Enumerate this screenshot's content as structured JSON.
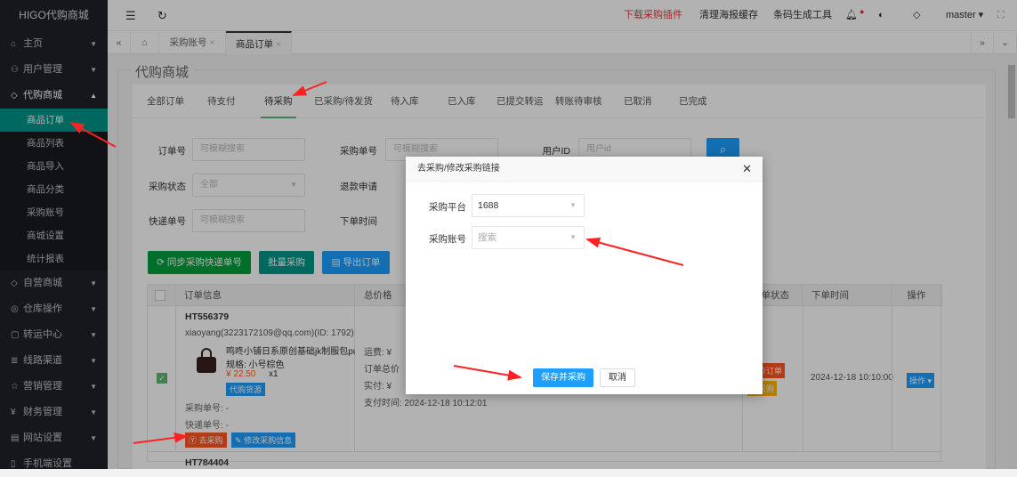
{
  "sidebar": {
    "logo": "HIGO代购商城",
    "items": [
      {
        "label": "主页",
        "icon": "home-icon"
      },
      {
        "label": "用户管理",
        "icon": "user-icon"
      },
      {
        "label": "代购商城",
        "icon": "tag-icon"
      }
    ],
    "sub": [
      "商品订单",
      "商品列表",
      "商品导入",
      "商品分类",
      "采购账号",
      "商城设置",
      "统计报表"
    ],
    "items2": [
      {
        "label": "自营商城",
        "icon": "tag-icon"
      },
      {
        "label": "仓库操作",
        "icon": "box-icon"
      },
      {
        "label": "转运中心",
        "icon": "note-icon"
      },
      {
        "label": "线路渠道",
        "icon": "route-icon"
      },
      {
        "label": "营销管理",
        "icon": "star-icon"
      },
      {
        "label": "财务管理",
        "icon": "yen-icon"
      },
      {
        "label": "网站设置",
        "icon": "window-icon"
      },
      {
        "label": "手机端设置",
        "icon": "phone-icon"
      }
    ]
  },
  "topbar": {
    "plugin": "下载采购插件",
    "clear": "清理海报缓存",
    "barcode": "条码生成工具",
    "user": "master",
    "accent": "#e4393c"
  },
  "tabs": {
    "items": [
      "采购账号",
      "商品订单"
    ]
  },
  "page": {
    "title": "代购商城",
    "order_tabs": [
      "全部订单",
      "待支付",
      "待采购",
      "已采购/待发货",
      "待入库",
      "已入库",
      "已提交转运",
      "转账待审核",
      "已取消",
      "已完成"
    ],
    "filters": {
      "order_no": "订单号",
      "order_no_ph": "可模糊搜索",
      "purchase_no": "采购单号",
      "purchase_no_ph": "可模糊搜索",
      "user_id": "用户ID",
      "user_id_ph": "用户id",
      "status": "采购状态",
      "status_val": "全部",
      "refund": "退款申请",
      "express": "快递单号",
      "express_ph": "可模糊搜索",
      "time": "下单时间"
    },
    "buttons": {
      "sync": "同步采购快递单号",
      "batch": "批量采购",
      "export": "导出订单"
    },
    "table": {
      "headers": [
        "订单信息",
        "总价格",
        "订单状态",
        "下单时间",
        "操作"
      ],
      "row": {
        "order_no": "HT556379",
        "user": "xiaoyang(3223172109@qq.com)(ID: 1792)",
        "product": "鸣咚小铺日系原创基础jk制服包pu纟",
        "spec": "规格: 小号棕色",
        "price": "¥ 22.50",
        "qty": "x1",
        "badge": "代购货源",
        "purchase_no": "采购单号: -",
        "express_no": "快递单号: -",
        "go": "去采购",
        "edit": "修改采购信息",
        "freight": "运费: ¥",
        "total": "订单总价",
        "paid": "实付: ¥",
        "pay_time": "支付时间: 2024-12-18 10:12:01",
        "status1": "改价订单",
        "status2": "待采购",
        "order_time": "2024-12-18 10:10:00",
        "op": "操作"
      },
      "row2": {
        "order_no": "HT784404"
      }
    }
  },
  "modal": {
    "title": "去采购/修改采购链接",
    "platform_label": "采购平台",
    "platform": "1688",
    "account_label": "采购账号",
    "account_ph": "搜索",
    "save": "保存并采购",
    "cancel": "取消"
  }
}
